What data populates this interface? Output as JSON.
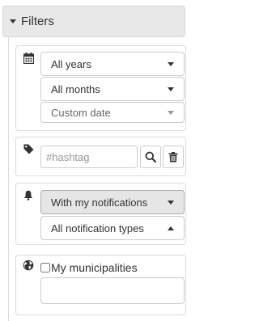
{
  "header": {
    "title": "Filters"
  },
  "date_filters": {
    "year_select": "All years",
    "month_select": "All months",
    "custom_date_select": "Custom date"
  },
  "hashtag_filter": {
    "placeholder": "#hashtag"
  },
  "notification_filters": {
    "notification_select": "With my notifications",
    "notification_types_select": "All notification types"
  },
  "municipality_filter": {
    "checkbox_label": "My municipalities",
    "checked": false
  },
  "icons": {
    "header": "caret-down-icon",
    "date": "calendar-icon",
    "hashtag": "tag-icon",
    "notifications": "bell-icon",
    "municipality": "globe-icon",
    "search": "search-icon",
    "delete": "trash-icon"
  },
  "colors": {
    "header_background": "#e8e8e8",
    "border": "#cccccc",
    "active_select": "#e6e6e6"
  }
}
